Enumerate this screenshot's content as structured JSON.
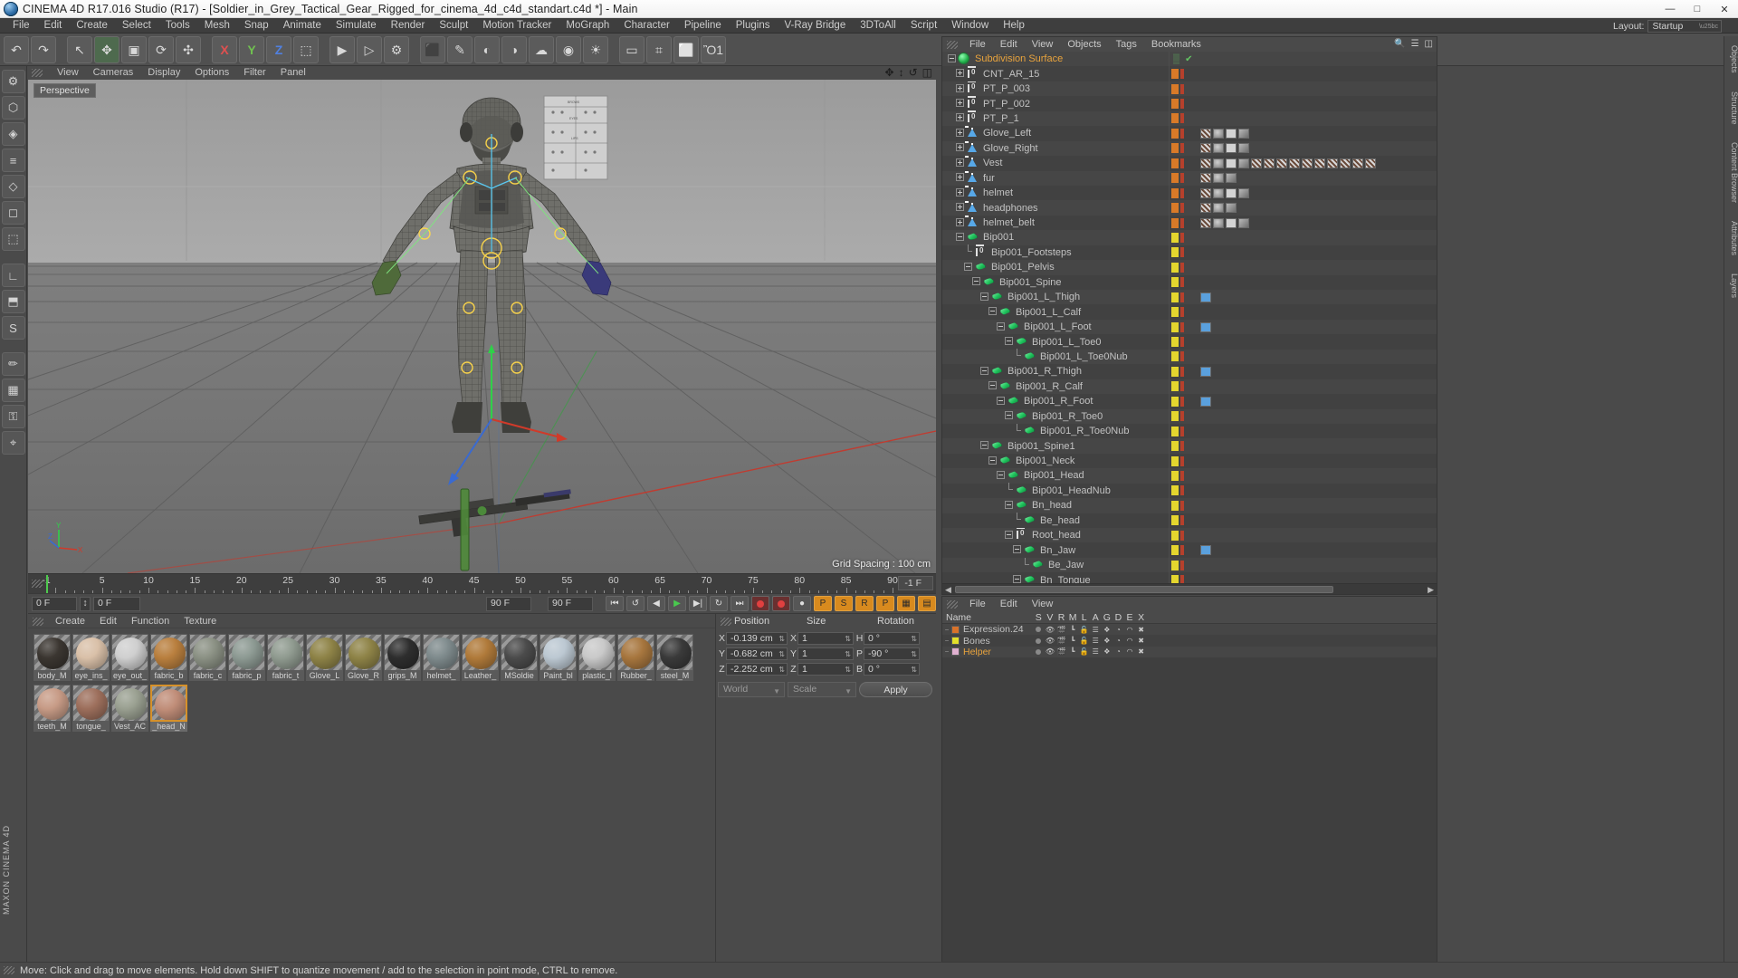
{
  "window": {
    "title": "CINEMA 4D R17.016 Studio (R17) - [Soldier_in_Grey_Tactical_Gear_Rigged_for_cinema_4d_c4d_standart.c4d *] - Main",
    "minimize": "—",
    "maximize": "□",
    "close": "✕"
  },
  "menubar": [
    "File",
    "Edit",
    "Create",
    "Select",
    "Tools",
    "Mesh",
    "Snap",
    "Animate",
    "Simulate",
    "Render",
    "Sculpt",
    "Motion Tracker",
    "MoGraph",
    "Character",
    "Pipeline",
    "Plugins",
    "V-Ray Bridge",
    "3DToAll",
    "Script",
    "Window",
    "Help"
  ],
  "layout": {
    "label": "Layout:",
    "value": "Startup"
  },
  "toolbar": [
    {
      "name": "undo-tool",
      "glyph": "↶"
    },
    {
      "name": "redo-tool",
      "glyph": "↷"
    },
    {
      "sep": true
    },
    {
      "name": "live-selection-tool",
      "glyph": "↖"
    },
    {
      "name": "move-tool",
      "glyph": "✥",
      "active": true
    },
    {
      "name": "scale-tool",
      "glyph": "▣"
    },
    {
      "name": "rotate-tool",
      "glyph": "⟳"
    },
    {
      "name": "transform-tool",
      "glyph": "✣"
    },
    {
      "sep": true
    },
    {
      "name": "x-axis-lock",
      "glyph": "X",
      "axis": "x"
    },
    {
      "name": "y-axis-lock",
      "glyph": "Y",
      "axis": "y"
    },
    {
      "name": "z-axis-lock",
      "glyph": "Z",
      "axis": "z"
    },
    {
      "name": "world-coordinate-toggle",
      "glyph": "⬚"
    },
    {
      "sep": true
    },
    {
      "name": "render-view-button",
      "glyph": "▶"
    },
    {
      "name": "render-region-button",
      "glyph": "▷"
    },
    {
      "name": "render-settings-button",
      "glyph": "⚙"
    },
    {
      "sep": true
    },
    {
      "name": "cube-primitive-button",
      "glyph": "⬛"
    },
    {
      "name": "spline-pen-button",
      "glyph": "✎"
    },
    {
      "name": "generator-button",
      "glyph": "◐"
    },
    {
      "name": "bend-deformer-button",
      "glyph": "◑"
    },
    {
      "name": "environment-button",
      "glyph": "☁"
    },
    {
      "name": "camera-button",
      "glyph": "◉"
    },
    {
      "name": "light-button",
      "glyph": "☀"
    },
    {
      "sep": true
    },
    {
      "name": "floor-button",
      "glyph": "▭"
    },
    {
      "name": "array-button",
      "glyph": "⌗"
    },
    {
      "name": "motion-camera-button",
      "glyph": "⬜"
    },
    {
      "name": "lamp-button",
      "glyph": "Ὂ1"
    }
  ],
  "lefttools": [
    {
      "name": "gear-tool",
      "glyph": "⚙"
    },
    {
      "name": "cube-mode-tool",
      "glyph": "⬡"
    },
    {
      "name": "point-mode-tool",
      "glyph": "◈"
    },
    {
      "name": "edge-mode-tool",
      "glyph": "≡"
    },
    {
      "name": "polygon-mode-tool",
      "glyph": "◇"
    },
    {
      "name": "model-mode-tool",
      "glyph": "◻"
    },
    {
      "name": "object-axis-tool",
      "glyph": "⬚"
    },
    {
      "sep": true
    },
    {
      "name": "texture-axis-tool",
      "glyph": "∟"
    },
    {
      "name": "workplane-tool",
      "glyph": "⬒"
    },
    {
      "name": "sculpt-tool",
      "glyph": "S"
    },
    {
      "sep": true
    },
    {
      "name": "paint-tool",
      "glyph": "✏"
    },
    {
      "name": "uv-tool",
      "glyph": "▦"
    },
    {
      "name": "lock-tool",
      "glyph": "⚿"
    },
    {
      "name": "snap-tool",
      "glyph": "⌖"
    }
  ],
  "brand": "MAXON CINEMA 4D",
  "viewport": {
    "menu": [
      "View",
      "Cameras",
      "Display",
      "Options",
      "Filter",
      "Panel"
    ],
    "perspective_label": "Perspective",
    "grid_spacing": "Grid Spacing : 100 cm",
    "nav_icons": [
      "pan-icon",
      "zoom-icon",
      "rotate-icon",
      "viewport-layout-icon"
    ],
    "axis": {
      "x": "X",
      "y": "Y",
      "z": "Z"
    }
  },
  "timeline": {
    "ticks": [
      -1,
      5,
      10,
      15,
      20,
      25,
      30,
      35,
      40,
      45,
      50,
      55,
      60,
      65,
      70,
      75,
      80,
      85,
      90
    ],
    "end_field": "-1 F"
  },
  "transport": {
    "current_frame": "0 F",
    "start_frame": "0 F",
    "end_frame_left": "90 F",
    "end_frame_right": "90 F",
    "buttons": [
      {
        "name": "go-to-start-button",
        "glyph": "⏮"
      },
      {
        "name": "step-back-button",
        "glyph": "↺"
      },
      {
        "name": "play-back-button",
        "glyph": "◀"
      },
      {
        "name": "play-button",
        "glyph": "▶",
        "accent": "play"
      },
      {
        "name": "step-forward-button",
        "glyph": "▶|"
      },
      {
        "name": "loop-button",
        "glyph": "↻"
      },
      {
        "name": "go-to-end-button",
        "glyph": "⏭"
      },
      {
        "name": "record-active-objects-button",
        "glyph": "●",
        "accent": "rec"
      },
      {
        "name": "autokey-button",
        "glyph": "●",
        "accent": "rec"
      },
      {
        "name": "keyframe-selection-button",
        "glyph": "●"
      },
      {
        "name": "position-key-button",
        "glyph": "P",
        "accent": "on"
      },
      {
        "name": "scale-key-button",
        "glyph": "S",
        "accent": "on"
      },
      {
        "name": "rotation-key-button",
        "glyph": "R",
        "accent": "on"
      },
      {
        "name": "param-key-button",
        "glyph": "P",
        "accent": "on"
      },
      {
        "name": "pla-button",
        "glyph": "▦",
        "accent": "on"
      },
      {
        "name": "animate-mode-button",
        "glyph": "▤",
        "accent": "on"
      }
    ]
  },
  "material_manager": {
    "menu": [
      "Create",
      "Edit",
      "Function",
      "Texture"
    ],
    "materials": [
      {
        "name": "body_M",
        "color": "#3b3631",
        "selected": false
      },
      {
        "name": "eye_ins_",
        "color": "#d9c0a8",
        "selected": false
      },
      {
        "name": "eye_out_",
        "color": "#cfcfcf",
        "selected": false
      },
      {
        "name": "fabric_b",
        "color": "#b97f3e",
        "selected": false
      },
      {
        "name": "fabric_c",
        "color": "#8b9184",
        "selected": false
      },
      {
        "name": "fabric_p",
        "color": "#8d9a93",
        "selected": false
      },
      {
        "name": "fabric_t",
        "color": "#909b90",
        "selected": false
      },
      {
        "name": "Glove_L",
        "color": "#8e8347",
        "selected": false
      },
      {
        "name": "Glove_R",
        "color": "#8e8347",
        "selected": false
      },
      {
        "name": "grips_M",
        "color": "#2e2e2e",
        "selected": false
      },
      {
        "name": "helmet_",
        "color": "#7e8a8c",
        "selected": false
      },
      {
        "name": "Leather_",
        "color": "#b07a3a",
        "selected": false
      },
      {
        "name": "MSoldie",
        "color": "#4b4b4b",
        "selected": false
      },
      {
        "name": "Paint_bl",
        "color": "#bcc8d2",
        "selected": false
      },
      {
        "name": "plastic_l",
        "color": "#c9c9c9",
        "selected": false
      },
      {
        "name": "Rubber_",
        "color": "#a7763e",
        "selected": false
      },
      {
        "name": "steel_M",
        "color": "#3a3a3a",
        "selected": false
      },
      {
        "name": "teeth_M",
        "color": "#c79b86",
        "selected": false
      },
      {
        "name": "tongue_",
        "color": "#9d6f5c",
        "selected": false
      },
      {
        "name": "Vest_AC",
        "color": "#9aa091",
        "selected": false
      },
      {
        "name": "_head_N",
        "color": "#c08d78",
        "selected": true
      }
    ]
  },
  "coordinates": {
    "headers": [
      "Position",
      "Size",
      "Rotation"
    ],
    "rows": [
      {
        "pos_axis": "X",
        "pos": "-0.139 cm",
        "size_axis": "X",
        "size": "1",
        "rot_axis": "H",
        "rot": "0 °"
      },
      {
        "pos_axis": "Y",
        "pos": "-0.682 cm",
        "size_axis": "Y",
        "size": "1",
        "rot_axis": "P",
        "rot": "-90 °"
      },
      {
        "pos_axis": "Z",
        "pos": "-2.252 cm",
        "size_axis": "Z",
        "size": "1",
        "rot_axis": "B",
        "rot": "0 °"
      }
    ],
    "coord_system": "World",
    "size_mode": "Scale",
    "apply_label": "Apply"
  },
  "object_manager": {
    "menu": [
      "File",
      "Edit",
      "View",
      "Objects",
      "Tags",
      "Bookmarks"
    ],
    "items": [
      {
        "label": "Subdivision Surface",
        "depth": 0,
        "icon": "subdivision-surface-icon",
        "selected": true,
        "expander": "minus",
        "markers": [
          "check"
        ],
        "tags": []
      },
      {
        "label": "CNT_AR_15",
        "depth": 1,
        "icon": "null-object-icon",
        "expander": "plus",
        "markers": [
          "orange",
          "red"
        ],
        "tags": []
      },
      {
        "label": "PT_P_003",
        "depth": 1,
        "icon": "null-object-icon",
        "expander": "plus",
        "markers": [
          "orange",
          "red"
        ],
        "tags": []
      },
      {
        "label": "PT_P_002",
        "depth": 1,
        "icon": "null-object-icon",
        "expander": "plus",
        "markers": [
          "orange",
          "red"
        ],
        "tags": []
      },
      {
        "label": "PT_P_1",
        "depth": 1,
        "icon": "null-object-icon",
        "expander": "plus",
        "markers": [
          "orange",
          "red"
        ],
        "tags": []
      },
      {
        "label": "Glove_Left",
        "depth": 1,
        "icon": "polygon-object-icon",
        "expander": "plus",
        "markers": [
          "orange",
          "red"
        ],
        "tags": [
          "weight",
          "texture",
          "phong",
          "mat"
        ]
      },
      {
        "label": "Glove_Right",
        "depth": 1,
        "icon": "polygon-object-icon",
        "expander": "plus",
        "markers": [
          "orange",
          "red"
        ],
        "tags": [
          "weight",
          "texture",
          "phong",
          "mat"
        ]
      },
      {
        "label": "Vest",
        "depth": 1,
        "icon": "polygon-object-icon",
        "expander": "plus",
        "markers": [
          "orange",
          "red"
        ],
        "tags": [
          "weight",
          "texture",
          "phong",
          "mat",
          "many"
        ]
      },
      {
        "label": "fur",
        "depth": 1,
        "icon": "polygon-object-icon",
        "expander": "plus",
        "markers": [
          "orange",
          "red"
        ],
        "tags": [
          "weight",
          "texture",
          "mat"
        ]
      },
      {
        "label": "helmet",
        "depth": 1,
        "icon": "polygon-object-icon",
        "expander": "plus",
        "markers": [
          "orange",
          "red"
        ],
        "tags": [
          "weight",
          "texture",
          "phong",
          "mat"
        ]
      },
      {
        "label": "headphones",
        "depth": 1,
        "icon": "polygon-object-icon",
        "expander": "plus",
        "markers": [
          "orange",
          "red"
        ],
        "tags": [
          "weight",
          "texture",
          "mat"
        ]
      },
      {
        "label": "helmet_belt",
        "depth": 1,
        "icon": "polygon-object-icon",
        "expander": "plus",
        "markers": [
          "orange",
          "red"
        ],
        "tags": [
          "weight",
          "texture",
          "phong",
          "mat"
        ]
      },
      {
        "label": "Bip001",
        "depth": 1,
        "icon": "bone-icon",
        "expander": "minus",
        "markers": [
          "yellow",
          "red"
        ],
        "tags": []
      },
      {
        "label": "Bip001_Footsteps",
        "depth": 2,
        "icon": "null-object-icon",
        "expander": "leaf",
        "markers": [
          "yellow",
          "red"
        ],
        "tags": []
      },
      {
        "label": "Bip001_Pelvis",
        "depth": 2,
        "icon": "bone-icon",
        "expander": "minus",
        "markers": [
          "yellow",
          "red"
        ],
        "tags": []
      },
      {
        "label": "Bip001_Spine",
        "depth": 3,
        "icon": "bone-icon",
        "expander": "minus",
        "markers": [
          "yellow",
          "red"
        ],
        "tags": []
      },
      {
        "label": "Bip001_L_Thigh",
        "depth": 4,
        "icon": "bone-icon",
        "expander": "minus",
        "markers": [
          "yellow",
          "red"
        ],
        "tags": [
          "xpr"
        ]
      },
      {
        "label": "Bip001_L_Calf",
        "depth": 5,
        "icon": "bone-icon",
        "expander": "minus",
        "markers": [
          "yellow",
          "red"
        ],
        "tags": []
      },
      {
        "label": "Bip001_L_Foot",
        "depth": 6,
        "icon": "bone-icon",
        "expander": "minus",
        "markers": [
          "yellow",
          "red"
        ],
        "tags": [
          "xpr2"
        ]
      },
      {
        "label": "Bip001_L_Toe0",
        "depth": 7,
        "icon": "bone-icon",
        "expander": "minus",
        "markers": [
          "yellow",
          "red"
        ],
        "tags": []
      },
      {
        "label": "Bip001_L_Toe0Nub",
        "depth": 8,
        "icon": "bone-icon",
        "expander": "leaf",
        "markers": [
          "yellow",
          "red"
        ],
        "tags": []
      },
      {
        "label": "Bip001_R_Thigh",
        "depth": 4,
        "icon": "bone-icon",
        "expander": "minus",
        "markers": [
          "yellow",
          "red"
        ],
        "tags": [
          "xpr"
        ]
      },
      {
        "label": "Bip001_R_Calf",
        "depth": 5,
        "icon": "bone-icon",
        "expander": "minus",
        "markers": [
          "yellow",
          "red"
        ],
        "tags": []
      },
      {
        "label": "Bip001_R_Foot",
        "depth": 6,
        "icon": "bone-icon",
        "expander": "minus",
        "markers": [
          "yellow",
          "red"
        ],
        "tags": [
          "xpr2"
        ]
      },
      {
        "label": "Bip001_R_Toe0",
        "depth": 7,
        "icon": "bone-icon",
        "expander": "minus",
        "markers": [
          "yellow",
          "red"
        ],
        "tags": []
      },
      {
        "label": "Bip001_R_Toe0Nub",
        "depth": 8,
        "icon": "bone-icon",
        "expander": "leaf",
        "markers": [
          "yellow",
          "red"
        ],
        "tags": []
      },
      {
        "label": "Bip001_Spine1",
        "depth": 4,
        "icon": "bone-icon",
        "expander": "minus",
        "markers": [
          "yellow",
          "red"
        ],
        "tags": []
      },
      {
        "label": "Bip001_Neck",
        "depth": 5,
        "icon": "bone-icon",
        "expander": "minus",
        "markers": [
          "yellow",
          "red"
        ],
        "tags": []
      },
      {
        "label": "Bip001_Head",
        "depth": 6,
        "icon": "bone-icon",
        "expander": "minus",
        "markers": [
          "yellow",
          "red"
        ],
        "tags": []
      },
      {
        "label": "Bip001_HeadNub",
        "depth": 7,
        "icon": "bone-icon",
        "expander": "leaf",
        "markers": [
          "yellow",
          "red"
        ],
        "tags": []
      },
      {
        "label": "Bn_head",
        "depth": 7,
        "icon": "bone-icon",
        "expander": "minus",
        "markers": [
          "yellow",
          "red"
        ],
        "tags": []
      },
      {
        "label": "Be_head",
        "depth": 8,
        "icon": "bone-icon",
        "expander": "leaf",
        "markers": [
          "yellow",
          "red"
        ],
        "tags": []
      },
      {
        "label": "Root_head",
        "depth": 7,
        "icon": "null-object-icon",
        "expander": "minus",
        "markers": [
          "yellow",
          "red"
        ],
        "tags": []
      },
      {
        "label": "Bn_Jaw",
        "depth": 8,
        "icon": "bone-icon",
        "expander": "minus",
        "markers": [
          "yellow",
          "red"
        ],
        "tags": [
          "xpr"
        ]
      },
      {
        "label": "Be_Jaw",
        "depth": 9,
        "icon": "bone-icon",
        "expander": "leaf",
        "markers": [
          "yellow",
          "red"
        ],
        "tags": []
      },
      {
        "label": "Bn_Tongue",
        "depth": 8,
        "icon": "bone-icon",
        "expander": "minus",
        "markers": [
          "yellow",
          "red"
        ],
        "tags": []
      }
    ]
  },
  "attribute_manager": {
    "menu": [
      "File",
      "Edit",
      "View"
    ],
    "columns": [
      "Name",
      "S",
      "V",
      "R",
      "M",
      "L",
      "A",
      "G",
      "D",
      "E",
      "X"
    ],
    "layers": [
      {
        "name": "Expression.24",
        "color": "#d8722a",
        "selected": false
      },
      {
        "name": "Bones",
        "color": "#e4e02a",
        "selected": false
      },
      {
        "name": "Helper",
        "color": "#e0b0d0",
        "selected": true
      }
    ]
  },
  "right_dock": [
    "Objects",
    "Structure",
    "Content Browser",
    "Attributes",
    "Layers"
  ],
  "statusbar": {
    "text": "Move: Click and drag to move elements. Hold down SHIFT to quantize movement / add to the selection in point mode, CTRL to remove."
  }
}
